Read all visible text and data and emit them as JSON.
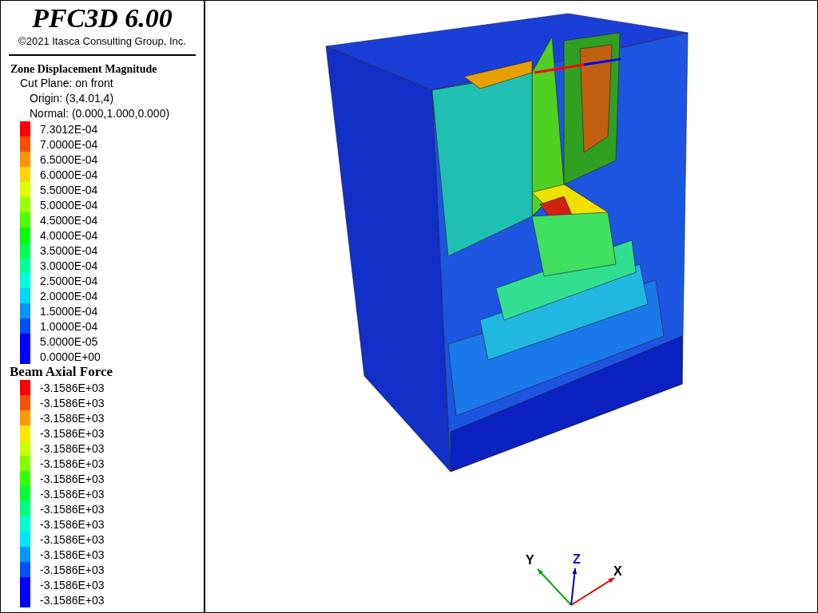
{
  "title": "PFC3D 6.00",
  "copyright": "©2021 Itasca Consulting Group, Inc.",
  "legends": [
    {
      "title": "Zone Displacement Magnitude",
      "info": [
        "Cut Plane: on front",
        "Origin: (3,4.01,4)",
        "Normal: (0.000,1.000,0.000)"
      ],
      "entries": [
        {
          "label": "7.3012E-04",
          "color": "#ff0000"
        },
        {
          "label": "7.0000E-04",
          "color": "#ff4d00"
        },
        {
          "label": "6.5000E-04",
          "color": "#ff9400"
        },
        {
          "label": "6.0000E-04",
          "color": "#ffd700"
        },
        {
          "label": "5.5000E-04",
          "color": "#dbff00"
        },
        {
          "label": "5.0000E-04",
          "color": "#99ff00"
        },
        {
          "label": "4.5000E-04",
          "color": "#4dff00"
        },
        {
          "label": "4.0000E-04",
          "color": "#00ff00"
        },
        {
          "label": "3.5000E-04",
          "color": "#00ff4d"
        },
        {
          "label": "3.0000E-04",
          "color": "#00ff94"
        },
        {
          "label": "2.5000E-04",
          "color": "#00ffdb"
        },
        {
          "label": "2.0000E-04",
          "color": "#00d7ff"
        },
        {
          "label": "1.5000E-04",
          "color": "#0094ff"
        },
        {
          "label": "1.0000E-04",
          "color": "#004dff"
        },
        {
          "label": "5.0000E-05",
          "color": "#0000ff"
        },
        {
          "label": "0.0000E+00",
          "color": "#0000ff"
        }
      ]
    },
    {
      "title": "Beam Axial Force",
      "entries": [
        {
          "label": "-3.1586E+03",
          "color": "#ff0000"
        },
        {
          "label": "-3.1586E+03",
          "color": "#ff5000"
        },
        {
          "label": "-3.1586E+03",
          "color": "#ff9900"
        },
        {
          "label": "-3.1586E+03",
          "color": "#ffe600"
        },
        {
          "label": "-3.1586E+03",
          "color": "#ccff00"
        },
        {
          "label": "-3.1586E+03",
          "color": "#80ff00"
        },
        {
          "label": "-3.1586E+03",
          "color": "#33ff00"
        },
        {
          "label": "-3.1586E+03",
          "color": "#00ff33"
        },
        {
          "label": "-3.1586E+03",
          "color": "#00ff80"
        },
        {
          "label": "-3.1586E+03",
          "color": "#00ffcc"
        },
        {
          "label": "-3.1586E+03",
          "color": "#00e6ff"
        },
        {
          "label": "-3.1586E+03",
          "color": "#0099ff"
        },
        {
          "label": "-3.1586E+03",
          "color": "#004fff"
        },
        {
          "label": "-3.1586E+03",
          "color": "#0000ff"
        },
        {
          "label": "-3.1586E+03",
          "color": "#0000ff"
        }
      ]
    }
  ],
  "axes": {
    "x": "X",
    "y": "Y",
    "z": "Z"
  }
}
